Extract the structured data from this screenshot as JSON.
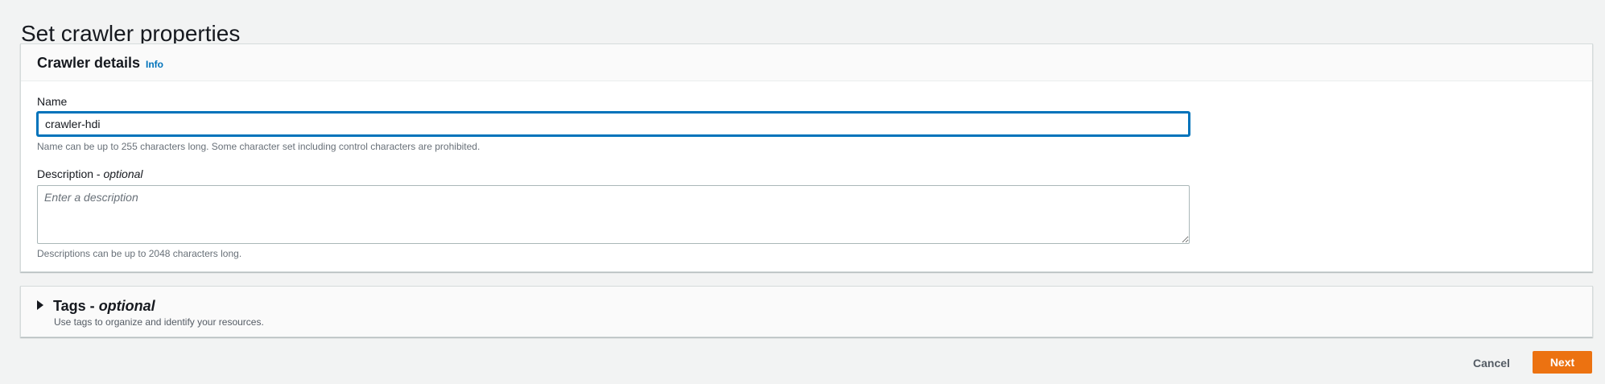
{
  "page": {
    "title": "Set crawler properties"
  },
  "crawler_details": {
    "header_title": "Crawler details",
    "info_link": "Info",
    "name": {
      "label": "Name",
      "value": "crawler-hdi",
      "hint": "Name can be up to 255 characters long. Some character set including control characters are prohibited."
    },
    "description": {
      "label_main": "Description -",
      "label_optional": "optional",
      "placeholder": "Enter a description",
      "value": "",
      "hint": "Descriptions can be up to 2048 characters long."
    }
  },
  "tags": {
    "title_main": "Tags -",
    "title_optional": "optional",
    "description": "Use tags to organize and identify your resources.",
    "expanded": false,
    "toggle_icon": "caret-right-icon"
  },
  "footer": {
    "cancel_label": "Cancel",
    "next_label": "Next"
  },
  "colors": {
    "accent": "#0073bb",
    "primary_button": "#ec7211",
    "background": "#f2f3f3"
  }
}
